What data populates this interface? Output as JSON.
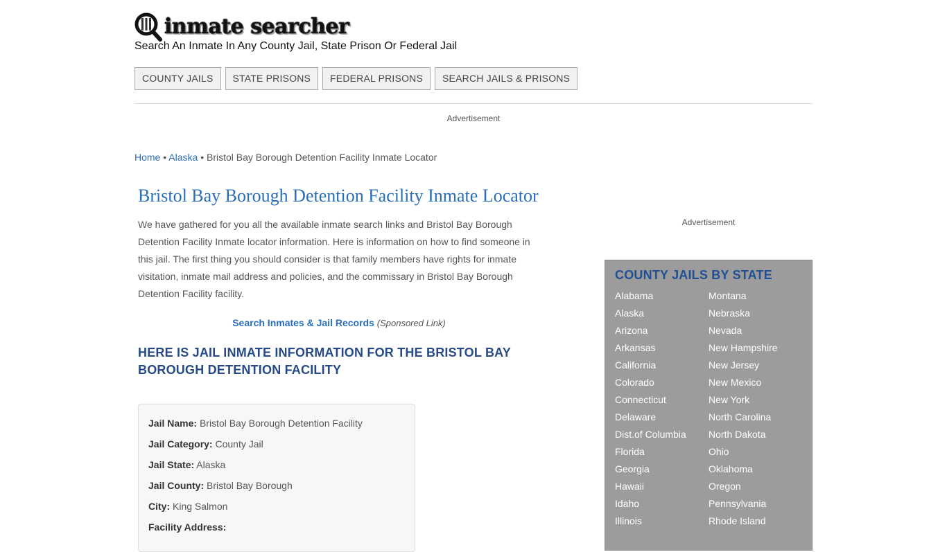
{
  "header": {
    "logo_text": "inmate searcher",
    "tagline": "Search An Inmate In Any County Jail, State Prison Or Federal Jail"
  },
  "nav": [
    {
      "label": "COUNTY JAILS"
    },
    {
      "label": "STATE PRISONS"
    },
    {
      "label": "FEDERAL PRISONS"
    },
    {
      "label": "SEARCH JAILS & PRISONS"
    }
  ],
  "ads": {
    "top": "Advertisement",
    "side": "Advertisement"
  },
  "breadcrumb": {
    "home": "Home",
    "sep1": " • ",
    "state": "Alaska",
    "sep2": " • ",
    "current": "Bristol Bay Borough Detention Facility Inmate Locator"
  },
  "main": {
    "title": "Bristol Bay Borough Detention Facility Inmate Locator",
    "intro": "We have gathered for you all the available inmate search links and Bristol Bay Borough Detention Facility Inmate locator information. Here is information on how to find someone in this jail. The first thing you should consider is that family members have rights for inmate visitation, inmate mail address and policies, and the commissary in Bristol Bay Borough Detention Facility facility.",
    "sponsored_link": "Search Inmates & Jail Records",
    "sponsored_note": "(Sponsored Link)",
    "section_title": "Here is Jail Inmate Information for the Bristol Bay Borough Detention Facility",
    "info": [
      {
        "label": "Jail Name:",
        "value": "Bristol Bay Borough Detention Facility"
      },
      {
        "label": "Jail Category:",
        "value": "County Jail"
      },
      {
        "label": "Jail State:",
        "value": "Alaska"
      },
      {
        "label": "Jail County:",
        "value": "Bristol Bay Borough"
      },
      {
        "label": "City:",
        "value": "King Salmon"
      },
      {
        "label": "Facility Address:",
        "value": ""
      }
    ]
  },
  "sidebar": {
    "title": "COUNTY JAILS BY STATE",
    "col1": [
      "Alabama",
      "Alaska",
      "Arizona",
      "Arkansas",
      "California",
      "Colorado",
      "Connecticut",
      "Delaware",
      "Dist.of Columbia",
      "Florida",
      "Georgia",
      "Hawaii",
      "Idaho",
      "Illinois"
    ],
    "col2": [
      "Montana",
      "Nebraska",
      "Nevada",
      "New Hampshire",
      "New Jersey",
      "New Mexico",
      "New York",
      "North Carolina",
      "North Dakota",
      "Ohio",
      "Oklahoma",
      "Oregon",
      "Pennsylvania",
      "Rhode Island"
    ]
  },
  "colors": {
    "link": "#2a6ebb",
    "section_title": "#274a86",
    "sidebar_bg": "#9c9c9c",
    "sidebar_title": "#1f4f94"
  }
}
